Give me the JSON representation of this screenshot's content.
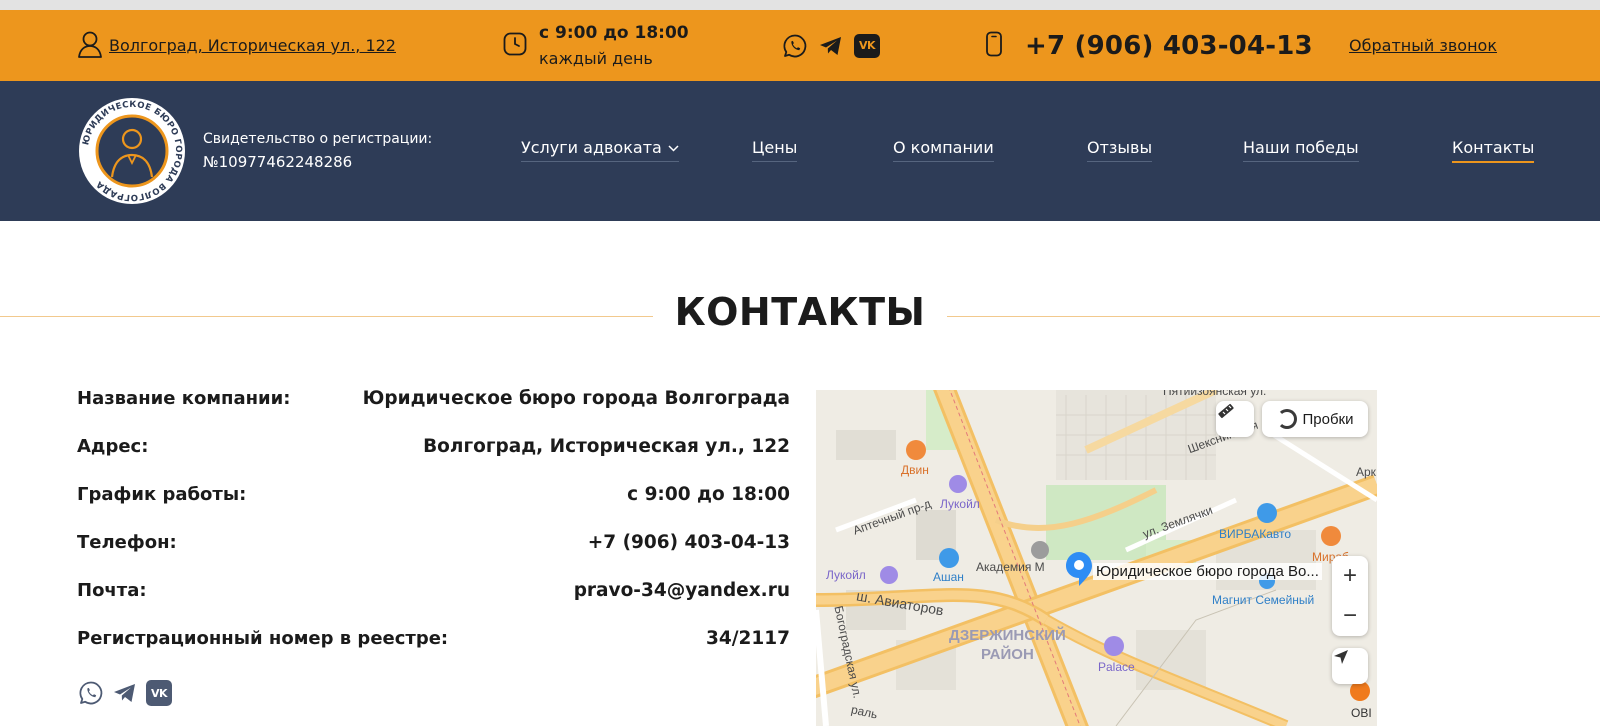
{
  "topbar": {
    "address": "Волгоград, Историческая ул., 122",
    "hours_main": "с 9:00 до 18:00",
    "hours_sub": "каждый день",
    "phone": "+7 (906) 403-04-13",
    "callback": "Обратный звонок",
    "socials": [
      "whatsapp-icon",
      "telegram-icon",
      "vk-icon"
    ],
    "vk_text": "VK"
  },
  "header": {
    "logo_text": "ЮРИДИЧЕСКОЕ БЮРО ГОРОДА ВОЛГОГРАДА",
    "reg_label": "Свидетельство о регистрации:",
    "reg_number": "№10977462248286",
    "nav": [
      {
        "label": "Услуги адвоката"
      },
      {
        "label": "Цены"
      },
      {
        "label": "О компании"
      },
      {
        "label": "Отзывы"
      },
      {
        "label": "Наши победы"
      },
      {
        "label": "Контакты"
      }
    ]
  },
  "main": {
    "title": "КОНТАКТЫ",
    "rows": [
      {
        "key": "Название компании:",
        "value": "Юридическое бюро города Волгограда"
      },
      {
        "key": "Адрес:",
        "value": "Волгоград, Историческая ул., 122"
      },
      {
        "key": "График работы:",
        "value": "с 9:00 до 18:00"
      },
      {
        "key": "Телефон:",
        "value": "+7 (906) 403-04-13"
      },
      {
        "key": "Почта:",
        "value": "pravo-34@yandex.ru"
      },
      {
        "key": "Регистрационный номер в реестре:",
        "value": "34/2117"
      }
    ]
  },
  "map": {
    "traffic_label": "Пробки",
    "pin_label": "Юридическое бюро города Во...",
    "zoom_in": "+",
    "zoom_out": "−",
    "district_line1": "ДЗЕРЖИНСКИЙ",
    "district_line2": "РАЙОН",
    "streets": [
      "Пятиизоянская ул.",
      "Шекснинская",
      "Арк",
      "ул. Землячки",
      "Аптечный пр-д",
      "ш. Авиаторов",
      "Академия М",
      "Богоградская ул.",
      "раль"
    ],
    "pois": [
      "Двин",
      "Лукойл",
      "Лукойл",
      "Ашан",
      "ВИРБАКавто",
      "Мираб",
      "Магнит Семейный",
      "Palace",
      "OBI"
    ]
  },
  "colors": {
    "accent": "#ed961d",
    "navy": "#2e3c57",
    "text": "#1b1b1b"
  }
}
